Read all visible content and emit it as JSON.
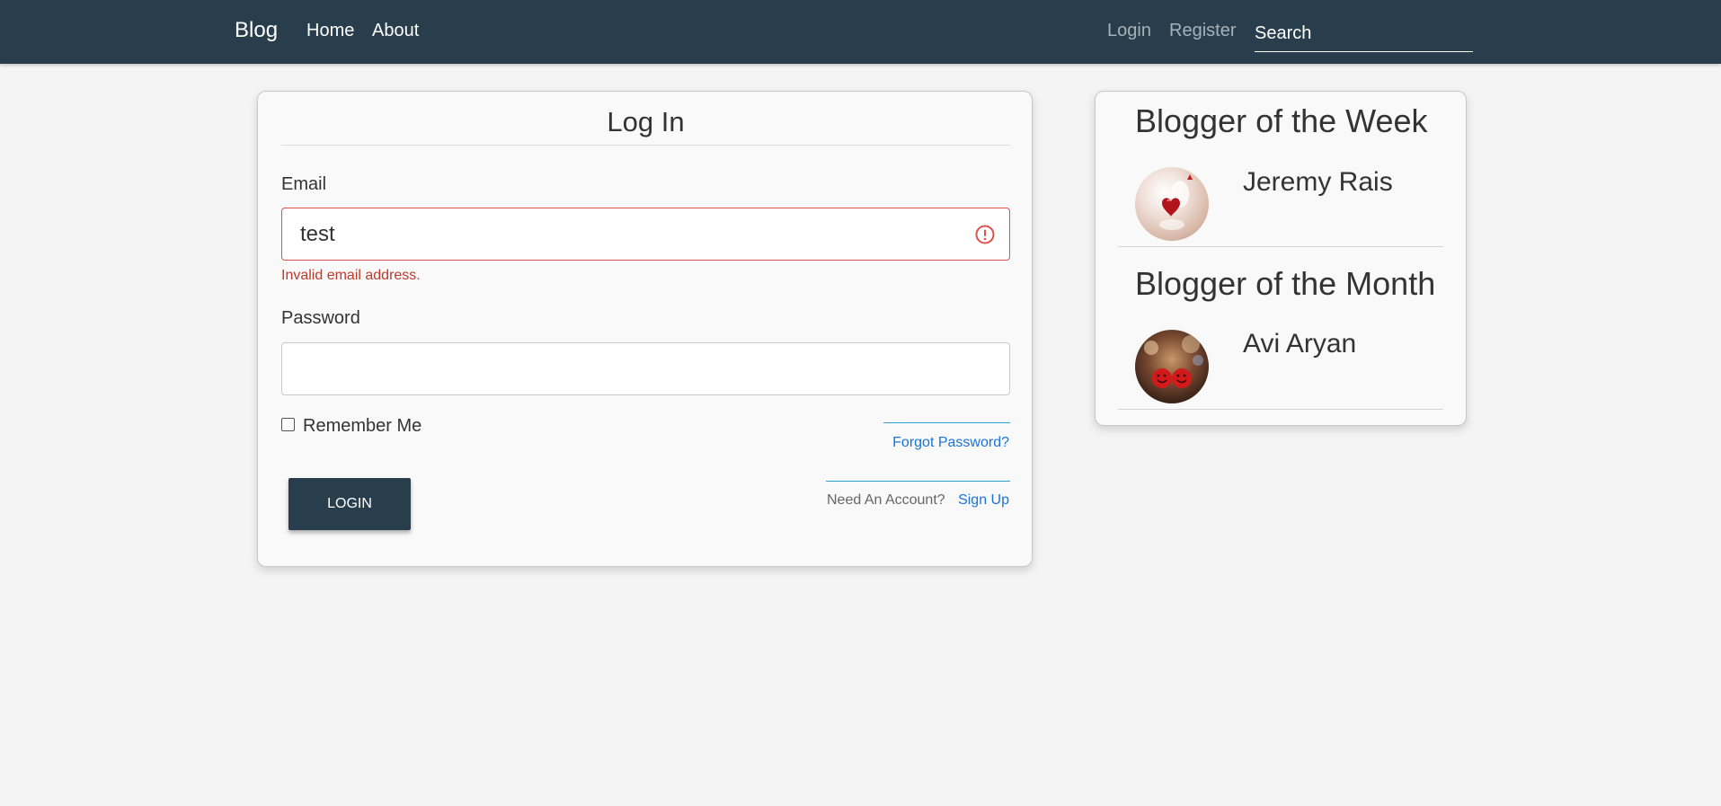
{
  "navbar": {
    "brand": "Blog",
    "links": [
      {
        "label": "Home"
      },
      {
        "label": "About"
      }
    ],
    "auth_links": [
      {
        "label": "Login"
      },
      {
        "label": "Register"
      }
    ],
    "search": {
      "placeholder": "Search",
      "value": ""
    },
    "background_color": "#283e4c"
  },
  "login_form": {
    "title": "Log In",
    "email": {
      "label": "Email",
      "value": "test",
      "error": "Invalid email address.",
      "error_icon": "exclamation-circle-icon"
    },
    "password": {
      "label": "Password",
      "value": ""
    },
    "remember_me": {
      "label": "Remember Me",
      "checked": false
    },
    "forgot_password": "Forgot Password?",
    "login_button": "LOGIN",
    "account_prompt": "Need An Account?",
    "signup_link": "Sign Up",
    "error_color": "#d9534f",
    "link_color": "#1a73d9"
  },
  "sidebar": {
    "week": {
      "heading": "Blogger of the Week",
      "name": "Jeremy Rais",
      "avatar": "heart-balloon-avatar"
    },
    "month": {
      "heading": "Blogger of the Month",
      "name": "Avi Aryan",
      "avatar": "smiley-faces-avatar"
    }
  }
}
